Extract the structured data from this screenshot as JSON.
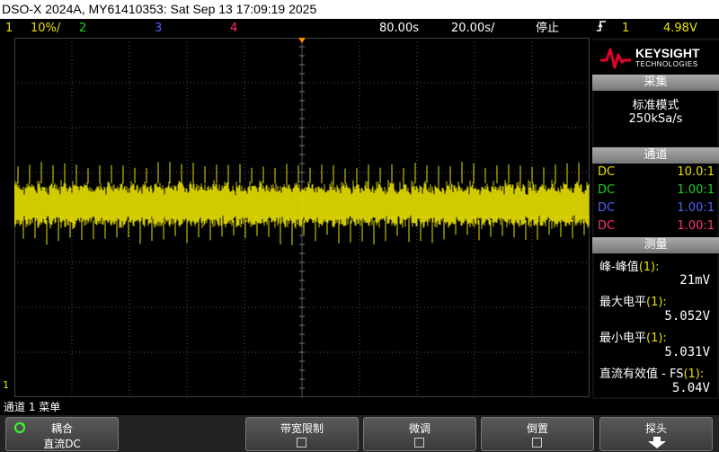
{
  "titlebar": {
    "text": "DSO-X 2024A, MY61410353: Sat Sep 13 17:09:19 2025"
  },
  "status": {
    "ch1_num": "1",
    "ch1_scale": "10%/",
    "ch2_num": "2",
    "ch3_num": "3",
    "ch4_num": "4",
    "delay": "80.00s",
    "timebase": "20.00s/",
    "run_state": "停止",
    "trig_channel": "1",
    "trig_level": "4.98V",
    "trig_icon": "trigger-edge-icon"
  },
  "logo": {
    "brand": "KEYSIGHT",
    "sub": "TECHNOLOGIES"
  },
  "acquisition": {
    "header": "采集",
    "mode": "标准模式",
    "rate": "250kSa/s"
  },
  "channels": {
    "header": "通道",
    "rows": [
      {
        "coupling": "DC",
        "probe": "10.0:1",
        "color": "#e8e000"
      },
      {
        "coupling": "DC",
        "probe": "1.00:1",
        "color": "#20d020"
      },
      {
        "coupling": "DC",
        "probe": "1.00:1",
        "color": "#5060ff"
      },
      {
        "coupling": "DC",
        "probe": "1.00:1",
        "color": "#ff3080"
      }
    ]
  },
  "measurements": {
    "header": "测量",
    "items": [
      {
        "label": "峰-峰值",
        "ch": "(1):",
        "value": "21mV"
      },
      {
        "label": "最大电平",
        "ch": "(1):",
        "value": "5.052V"
      },
      {
        "label": "最小电平",
        "ch": "(1):",
        "value": "5.031V"
      },
      {
        "label": "直流有效值 - FS",
        "ch": "(1):",
        "value": "5.04V"
      }
    ]
  },
  "message": "通道 1 菜单",
  "softkeys": {
    "coupling_title": "耦合",
    "coupling_value": "直流DC",
    "bw_limit": "带宽限制",
    "fine": "微调",
    "invert": "倒置",
    "probe": "探头"
  },
  "marker": {
    "ch1_ground": "1"
  },
  "colors": {
    "ch1": "#e8e000",
    "accent": "#ff8c00"
  }
}
